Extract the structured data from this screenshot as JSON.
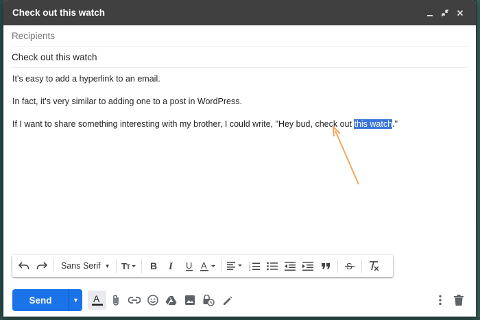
{
  "window": {
    "title": "Check out this watch"
  },
  "compose": {
    "recipients_placeholder": "Recipients",
    "subject": "Check out this watch",
    "body": {
      "line1": "It's easy to add a hyperlink to an email.",
      "line2": "In fact, it's very similar to adding one to a post in WordPress.",
      "line3_before": "If I want to share something interesting with my brother, I could write, \"Hey bud, check out ",
      "line3_selected": "this watch",
      "line3_after": ".\""
    }
  },
  "format_toolbar": {
    "font_name": "Sans Serif"
  },
  "bottom_bar": {
    "send_label": "Send"
  },
  "colors": {
    "titlebar": "#404040",
    "send_button": "#1a73e8",
    "selection": "#3b73d9",
    "arrow": "#f5a55a"
  }
}
